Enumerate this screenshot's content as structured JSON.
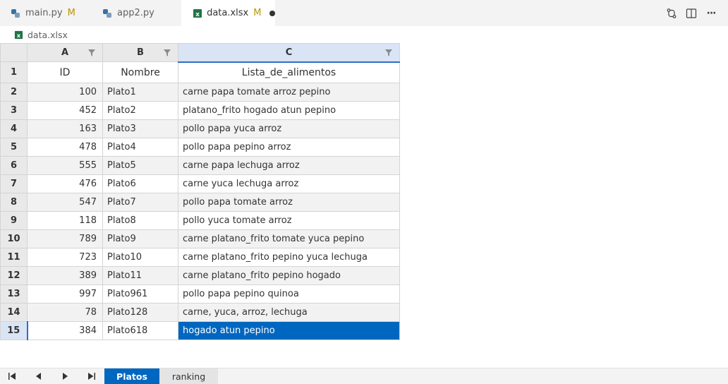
{
  "tabs": [
    {
      "label": "main.py",
      "status": "M",
      "icon": "python-icon"
    },
    {
      "label": "app2.py",
      "status": "",
      "icon": "python-icon"
    },
    {
      "label": "data.xlsx",
      "status": "M",
      "icon": "excel-icon",
      "active": true
    }
  ],
  "toolbar": {
    "actions": [
      "compare-changes-icon",
      "split-editor-icon",
      "more-actions-icon"
    ],
    "more_label": "···"
  },
  "breadcrumb": {
    "file": "data.xlsx",
    "icon": "excel-icon"
  },
  "grid": {
    "columns": [
      "A",
      "B",
      "C"
    ],
    "row_numbers": [
      "1",
      "2",
      "3",
      "4",
      "5",
      "6",
      "7",
      "8",
      "9",
      "10",
      "11",
      "12",
      "13",
      "14",
      "15"
    ],
    "header_row": [
      "ID",
      "Nombre",
      "Lista_de_alimentos"
    ],
    "rows": [
      [
        "100",
        "Plato1",
        "carne papa tomate arroz pepino"
      ],
      [
        "452",
        "Plato2",
        "platano_frito hogado atun pepino"
      ],
      [
        "163",
        "Plato3",
        "pollo papa yuca arroz"
      ],
      [
        "478",
        "Plato4",
        "pollo papa pepino arroz"
      ],
      [
        "555",
        "Plato5",
        "carne papa lechuga arroz"
      ],
      [
        "476",
        "Plato6",
        "carne yuca lechuga arroz"
      ],
      [
        "547",
        "Plato7",
        "pollo papa tomate arroz"
      ],
      [
        "118",
        "Plato8",
        "pollo yuca tomate arroz"
      ],
      [
        "789",
        "Plato9",
        "carne platano_frito tomate yuca pepino"
      ],
      [
        "723",
        "Plato10",
        "carne platano_frito pepino yuca lechuga"
      ],
      [
        "389",
        "Plato11",
        "carne platano_frito pepino hogado"
      ],
      [
        "997",
        "Plato961",
        "pollo papa pepino quinoa"
      ],
      [
        "78",
        "Plato128",
        "carne, yuca, arroz, lechuga"
      ],
      [
        "384",
        "Plato618",
        "hogado atun pepino"
      ]
    ]
  },
  "sheets": [
    "Platos",
    "ranking"
  ],
  "colors": {
    "accent": "#0067c0",
    "modified": "#b89500",
    "excel": "#217346",
    "python": "#3572a5"
  }
}
